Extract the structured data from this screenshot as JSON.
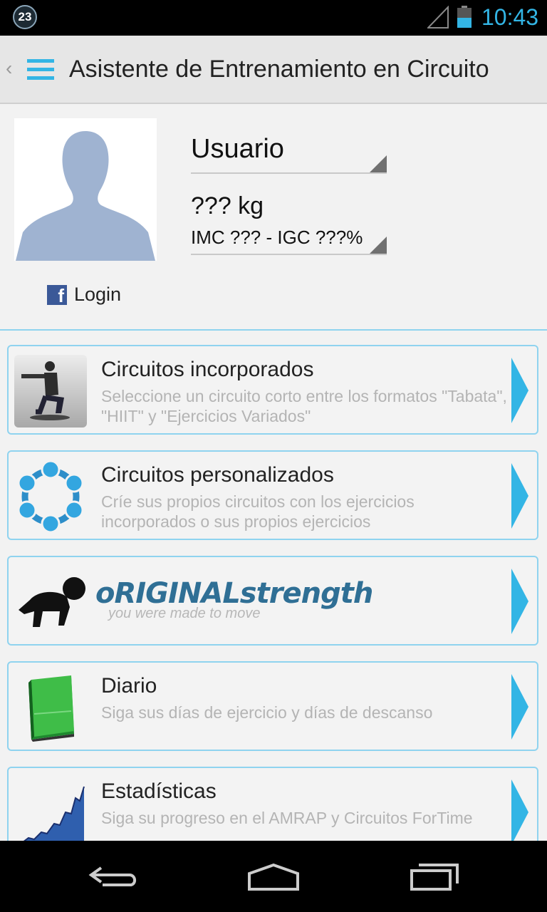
{
  "status_bar": {
    "notification_count": "23",
    "time": "10:43",
    "colors": {
      "accent": "#33b5e5"
    }
  },
  "action_bar": {
    "title": "Asistente de Entrenamiento en Circuito",
    "up_icon": "chevron-left-icon",
    "menu_icon": "menu-icon"
  },
  "profile": {
    "user_spinner": {
      "value": "Usuario"
    },
    "weight_spinner": {
      "weight": "??? kg",
      "indices": "IMC ??? - IGC ???%"
    },
    "facebook": {
      "label": "Login",
      "icon": "facebook-icon"
    }
  },
  "menu": [
    {
      "title": "Circuitos incorporados",
      "description": "Seleccione un circuito corto entre los formatos \"Tabata\", \"HIIT\" y \"Ejercicios Variados\"",
      "icon": "exercise-photo-icon"
    },
    {
      "title": "Circuitos personalizados",
      "description": "Críe sus propios circuitos con los ejercicios incorporados o sus propios ejercicios",
      "icon": "circle-nodes-icon"
    },
    {
      "logo_text": "oRIGINALstrength",
      "logo_tagline": "you were made to move",
      "icon": "crawling-baby-icon"
    },
    {
      "title": "Diario",
      "description": "Siga sus días de ejercicio y días de descanso",
      "icon": "green-book-icon"
    },
    {
      "title": "Estadísticas",
      "description": "Siga su progreso en el AMRAP y Circuitos ForTime",
      "icon": "growth-chart-icon"
    }
  ],
  "nav_bar": {
    "back": "back-icon",
    "home": "home-icon",
    "recents": "recent-apps-icon"
  }
}
